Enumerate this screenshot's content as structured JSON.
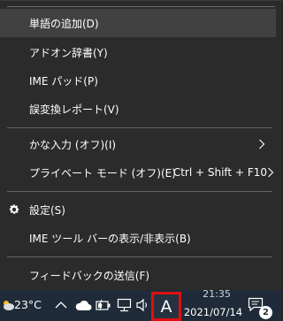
{
  "menu": {
    "items": [
      {
        "label": "単語の追加(D)"
      },
      {
        "label": "アドオン辞書(Y)"
      },
      {
        "label": "IME パッド(P)"
      },
      {
        "label": "誤変換レポート(V)"
      },
      {
        "label": "かな入力 (オフ)(I)"
      },
      {
        "label": "プライベート モード (オフ)(E)",
        "shortcut": "Ctrl + Shift + F10"
      },
      {
        "label": "設定(S)"
      },
      {
        "label": "IME ツール バーの表示/非表示(B)"
      },
      {
        "label": "フィードバックの送信(F)"
      }
    ]
  },
  "taskbar": {
    "temperature": "23°C",
    "ime_mode": "A",
    "time": "21:35",
    "date": "2021/07/14",
    "notification_count": "2",
    "highlight_color": "#e01010",
    "icons": [
      "weather-cloud-icon",
      "chevron-up-icon",
      "cloud-icon",
      "battery-icon",
      "network-icon",
      "speaker-icon",
      "notification-icon"
    ]
  }
}
